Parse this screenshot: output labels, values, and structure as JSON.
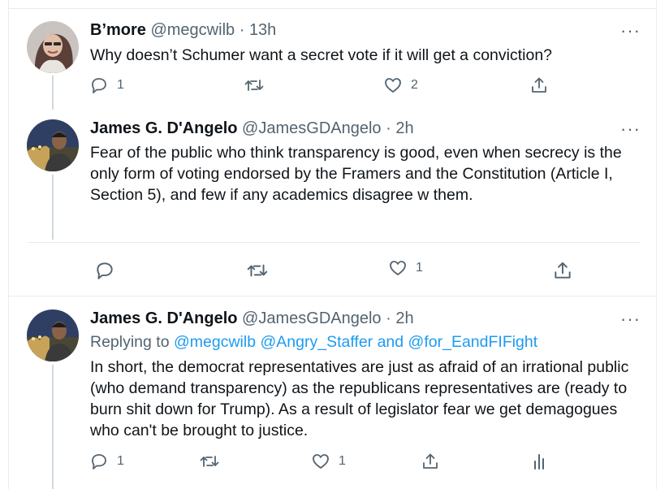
{
  "tweets": [
    {
      "name": "B’more",
      "handle": "@megcwilb",
      "separator": "·",
      "time": "13h",
      "text": "Why doesn’t Schumer want a secret vote if it will get a conviction?",
      "reply_count": "1",
      "retweet_count": "",
      "like_count": "2",
      "more_icon": "more-dots-icon"
    },
    {
      "name": "James G. D'Angelo",
      "handle": "@JamesGDAngelo",
      "separator": "·",
      "time": "2h",
      "text": "Fear of the public who think transparency is good, even when secrecy is the only form of voting endorsed by the Framers and the Constitution (Article I, Section 5), and few if any academics disagree w them.",
      "reply_count": "",
      "retweet_count": "",
      "like_count": "1"
    },
    {
      "name": "James G. D'Angelo",
      "handle": "@JamesGDAngelo",
      "separator": "·",
      "time": "2h",
      "replying_prefix": "Replying to",
      "mention_1": "@megcwilb",
      "mention_2": "@Angry_Staffer",
      "replying_and": "and",
      "mention_3": "@for_EandFIFight",
      "text": "In short, the democrat representatives are just as afraid of an irrational public (who demand transparency) as the republicans representatives are (ready to burn shit down for Trump). As a result of legislator fear we get demagogues who can't be brought to justice.",
      "reply_count": "1",
      "retweet_count": "",
      "like_count": "1"
    }
  ],
  "more_label": "···",
  "colors": {
    "text": "#0f1419",
    "secondary": "#536471",
    "link": "#1d9bf0",
    "border": "#e6ecf0"
  }
}
